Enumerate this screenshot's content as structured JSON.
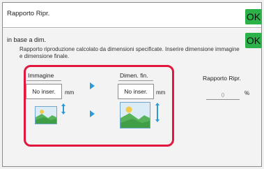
{
  "header": {
    "title": "Rapporto Ripr.",
    "ok_label": "OK"
  },
  "content": {
    "mode_label": "in base a dim.",
    "ok_label": "OK",
    "description": "Rapporto riproduzione calcolato da dimensioni specificate. Inserire dimensione immagine e dimensione finale.",
    "image": {
      "label": "Immagine",
      "field_value": "No inser.",
      "unit": "mm"
    },
    "final": {
      "label": "Dimen. fin.",
      "field_value": "No inser.",
      "unit": "mm"
    },
    "ratio": {
      "label": "Rapporto Ripr.",
      "value": "0",
      "unit": "%"
    }
  },
  "colors": {
    "ok_button": "#2bb34a",
    "highlight_frame": "#e1173f",
    "arrow": "#2a9bd4"
  },
  "icons": [
    "right-arrow-icon",
    "small-image-icon",
    "large-image-icon",
    "vertical-resize-icon"
  ]
}
